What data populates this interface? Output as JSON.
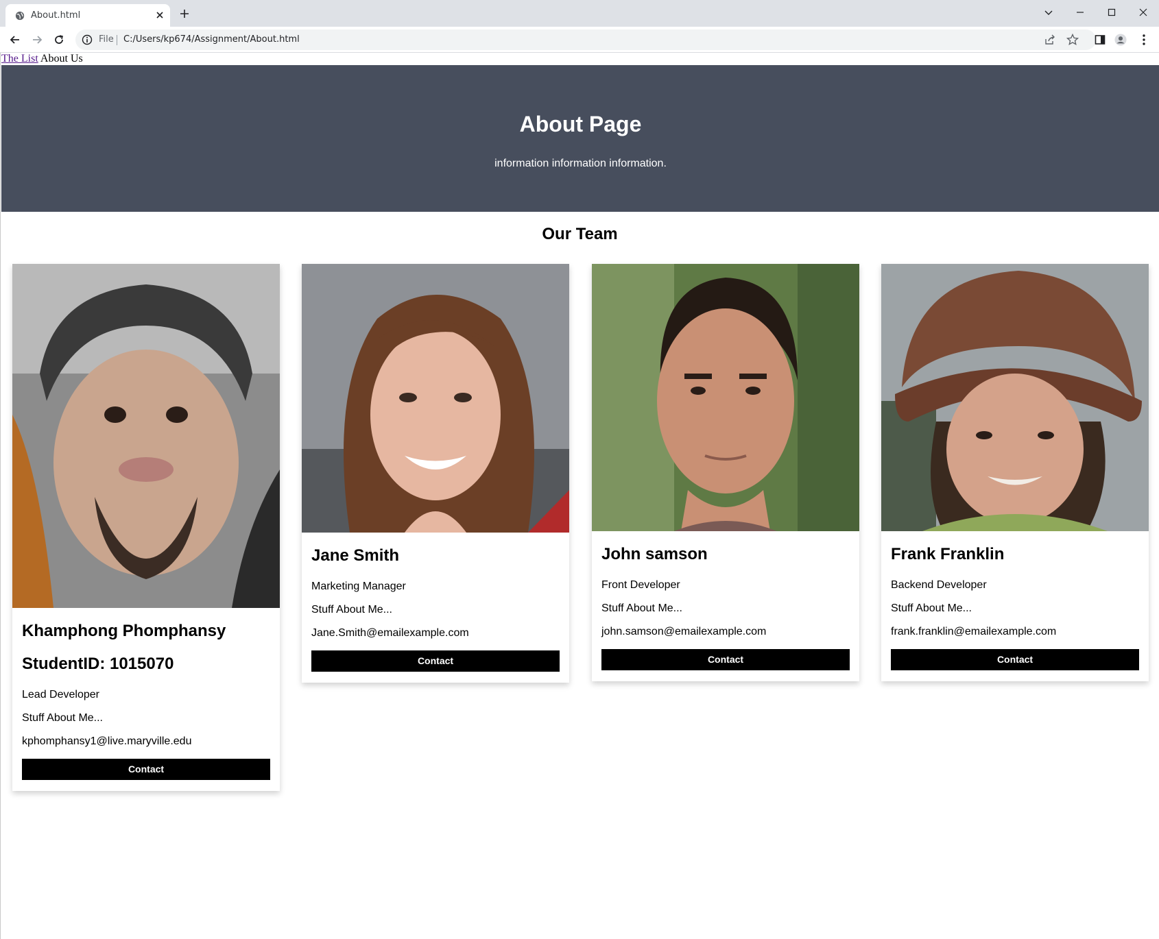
{
  "browser": {
    "tab_title": "About.html",
    "scheme_label": "File",
    "url": "C:/Users/kp674/Assignment/About.html"
  },
  "nav": {
    "link_list": "The List",
    "current": "About Us"
  },
  "hero": {
    "title": "About Page",
    "subtitle": "information information information.",
    "bg_color": "#474e5d"
  },
  "team": {
    "title": "Our Team",
    "members": [
      {
        "name": "Khamphong Phomphansy",
        "student_id": "StudentID: 1015070",
        "role": "Lead Developer",
        "about": "Stuff About Me...",
        "email": "kphomphansy1@live.maryville.edu",
        "button": "Contact",
        "photo_icon": "portrait-photo"
      },
      {
        "name": "Jane Smith",
        "role": "Marketing Manager",
        "about": "Stuff About Me...",
        "email": "Jane.Smith@emailexample.com",
        "button": "Contact",
        "photo_icon": "portrait-photo"
      },
      {
        "name": "John samson",
        "role": "Front Developer",
        "about": "Stuff About Me...",
        "email": "john.samson@emailexample.com",
        "button": "Contact",
        "photo_icon": "portrait-photo"
      },
      {
        "name": "Frank Franklin",
        "role": "Backend Developer",
        "about": "Stuff About Me...",
        "email": "frank.franklin@emailexample.com",
        "button": "Contact",
        "photo_icon": "portrait-photo"
      }
    ]
  }
}
